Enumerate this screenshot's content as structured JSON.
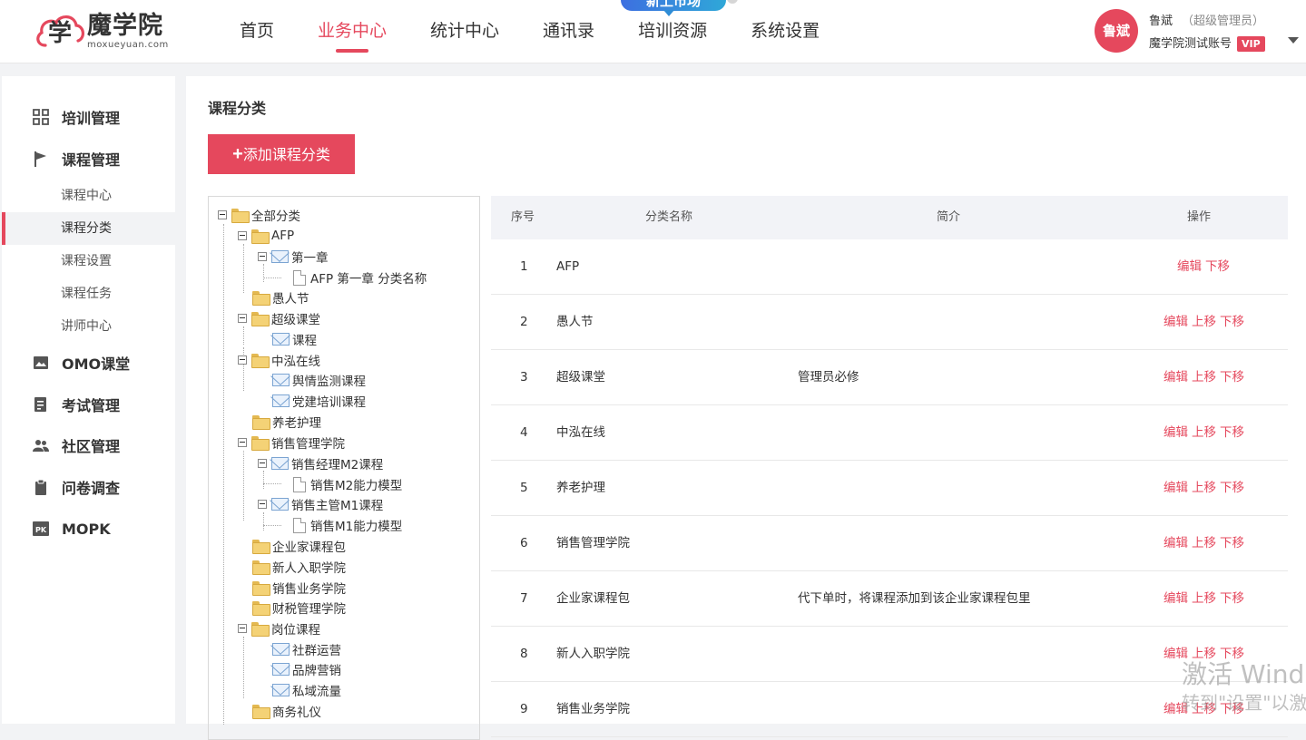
{
  "brand": {
    "name_cn": "魔学院",
    "name_en": "moxueyuan.com",
    "logo_char": "学",
    "accent": "#e5485d"
  },
  "nav": {
    "items": [
      "首页",
      "业务中心",
      "统计中心",
      "通讯录",
      "培训资源",
      "系统设置"
    ],
    "active": "业务中心",
    "bubble": "新上市场"
  },
  "user": {
    "avatar_text": "鲁斌",
    "name": "鲁斌",
    "role": "（超级管理员）",
    "account": "魔学院测试账号",
    "badge": "VIP"
  },
  "sidebar": {
    "groups": [
      {
        "label": "培训管理",
        "icon": "grid-icon"
      },
      {
        "label": "课程管理",
        "icon": "flag-icon",
        "children": [
          "课程中心",
          "课程分类",
          "课程设置",
          "课程任务",
          "讲师中心"
        ],
        "active_child": "课程分类"
      },
      {
        "label": "OMO课堂",
        "icon": "image-icon"
      },
      {
        "label": "考试管理",
        "icon": "exam-icon"
      },
      {
        "label": "社区管理",
        "icon": "people-icon"
      },
      {
        "label": "问卷调查",
        "icon": "clipboard-icon"
      },
      {
        "label": "MOPK",
        "icon": "pk-icon"
      }
    ]
  },
  "page": {
    "title": "课程分类",
    "add_button": "添加课程分类",
    "add_icon": "plus-icon"
  },
  "tree": {
    "nodes": [
      {
        "label": "全部分类",
        "icon": "folder-icon",
        "toggle": true
      },
      {
        "label": "AFP",
        "icon": "folder-icon",
        "toggle": true
      },
      {
        "label": "第一章",
        "icon": "mail-icon",
        "toggle": true
      },
      {
        "label": "AFP 第一章 分类名称",
        "icon": "doc-icon",
        "toggle": false
      },
      {
        "label": "愚人节",
        "icon": "folder-icon",
        "toggle": false
      },
      {
        "label": "超级课堂",
        "icon": "folder-icon",
        "toggle": true
      },
      {
        "label": "课程",
        "icon": "mail-icon",
        "toggle": false
      },
      {
        "label": "中泓在线",
        "icon": "folder-icon",
        "toggle": true
      },
      {
        "label": "舆情监测课程",
        "icon": "mail-icon",
        "toggle": false
      },
      {
        "label": "党建培训课程",
        "icon": "mail-icon",
        "toggle": false
      },
      {
        "label": "养老护理",
        "icon": "folder-icon",
        "toggle": false
      },
      {
        "label": "销售管理学院",
        "icon": "folder-icon",
        "toggle": true
      },
      {
        "label": "销售经理M2课程",
        "icon": "mail-icon",
        "toggle": true
      },
      {
        "label": "销售M2能力模型",
        "icon": "doc-icon",
        "toggle": false
      },
      {
        "label": "销售主管M1课程",
        "icon": "mail-icon",
        "toggle": true
      },
      {
        "label": "销售M1能力模型",
        "icon": "doc-icon",
        "toggle": false
      },
      {
        "label": "企业家课程包",
        "icon": "folder-icon",
        "toggle": false
      },
      {
        "label": "新人入职学院",
        "icon": "folder-icon",
        "toggle": false
      },
      {
        "label": "销售业务学院",
        "icon": "folder-icon",
        "toggle": false
      },
      {
        "label": "财税管理学院",
        "icon": "folder-icon",
        "toggle": false
      },
      {
        "label": "岗位课程",
        "icon": "folder-icon",
        "toggle": true
      },
      {
        "label": "社群运营",
        "icon": "mail-icon",
        "toggle": false
      },
      {
        "label": "品牌营销",
        "icon": "mail-icon",
        "toggle": false
      },
      {
        "label": "私域流量",
        "icon": "mail-icon",
        "toggle": false
      },
      {
        "label": "商务礼仪",
        "icon": "folder-icon",
        "toggle": false
      }
    ]
  },
  "table": {
    "headers": [
      "序号",
      "分类名称",
      "简介",
      "操作"
    ],
    "rows": [
      {
        "index": "1",
        "name": "AFP",
        "desc": "",
        "ops": [
          "编辑",
          "下移"
        ]
      },
      {
        "index": "2",
        "name": "愚人节",
        "desc": "",
        "ops": [
          "编辑",
          "上移",
          "下移"
        ]
      },
      {
        "index": "3",
        "name": "超级课堂",
        "desc": "管理员必修",
        "ops": [
          "编辑",
          "上移",
          "下移"
        ]
      },
      {
        "index": "4",
        "name": "中泓在线",
        "desc": "",
        "ops": [
          "编辑",
          "上移",
          "下移"
        ]
      },
      {
        "index": "5",
        "name": "养老护理",
        "desc": "",
        "ops": [
          "编辑",
          "上移",
          "下移"
        ]
      },
      {
        "index": "6",
        "name": "销售管理学院",
        "desc": "",
        "ops": [
          "编辑",
          "上移",
          "下移"
        ]
      },
      {
        "index": "7",
        "name": "企业家课程包",
        "desc": "代下单时，将课程添加到该企业家课程包里",
        "ops": [
          "编辑",
          "上移",
          "下移"
        ]
      },
      {
        "index": "8",
        "name": "新人入职学院",
        "desc": "",
        "ops": [
          "编辑",
          "上移",
          "下移"
        ]
      },
      {
        "index": "9",
        "name": "销售业务学院",
        "desc": "",
        "ops": [
          "编辑",
          "上移",
          "下移"
        ]
      }
    ]
  },
  "watermark": {
    "line1": "激活 Wind",
    "line2": "转到\"设置\"以激"
  }
}
